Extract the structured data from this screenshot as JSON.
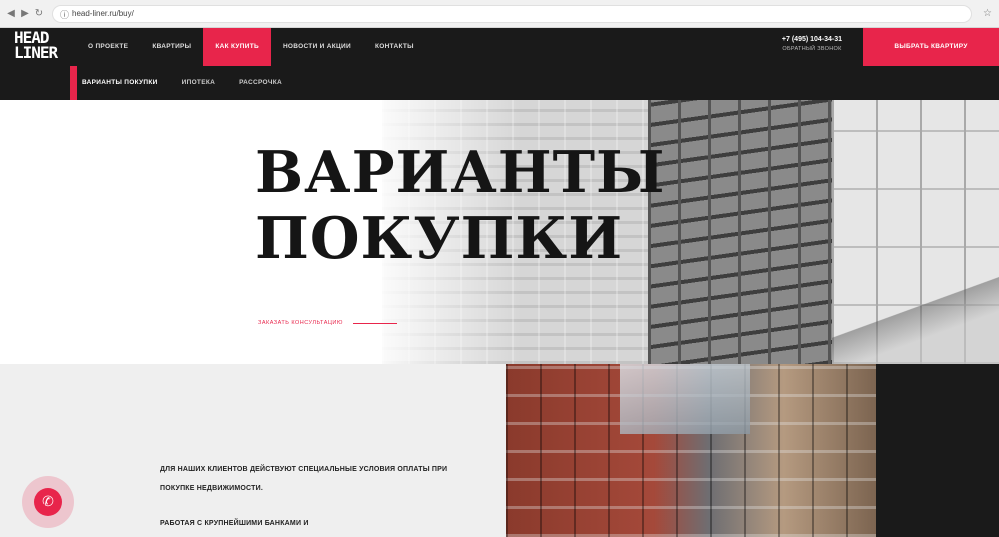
{
  "browser": {
    "url": "head-liner.ru/buy/"
  },
  "header": {
    "logo_text": "HEAD LINER",
    "nav": [
      "О ПРОЕКТЕ",
      "КВАРТИРЫ",
      "КАК КУПИТЬ",
      "НОВОСТИ И АКЦИИ",
      "КОНТАКТЫ"
    ],
    "nav_active_index": 2,
    "phone": "+7 (495) 104-34-31",
    "callback": "ОБРАТНЫЙ ЗВОНОК",
    "cta": "ВЫБРАТЬ КВАРТИРУ",
    "subnav": [
      "ВАРИАНТЫ ПОКУПКИ",
      "ИПОТЕКА",
      "РАССРОЧКА"
    ],
    "subnav_active_index": 0,
    "accent_color": "#e8254b"
  },
  "hero": {
    "title_line1": "ВАРИАНТЫ",
    "title_line2": "ПОКУПКИ",
    "consult_link": "ЗАКАЗАТЬ КОНСУЛЬТАЦИЮ"
  },
  "content": {
    "paragraph1": "ДЛЯ НАШИХ КЛИЕНТОВ ДЕЙСТВУЮТ СПЕЦИАЛЬНЫЕ УСЛОВИЯ ОПЛАТЫ ПРИ ПОКУПКЕ НЕДВИЖИМОСТИ.",
    "paragraph2": "РАБОТАЯ С КРУПНЕЙШИМИ БАНКАМИ И"
  },
  "icons": {
    "phone_fab": "phone-icon"
  }
}
